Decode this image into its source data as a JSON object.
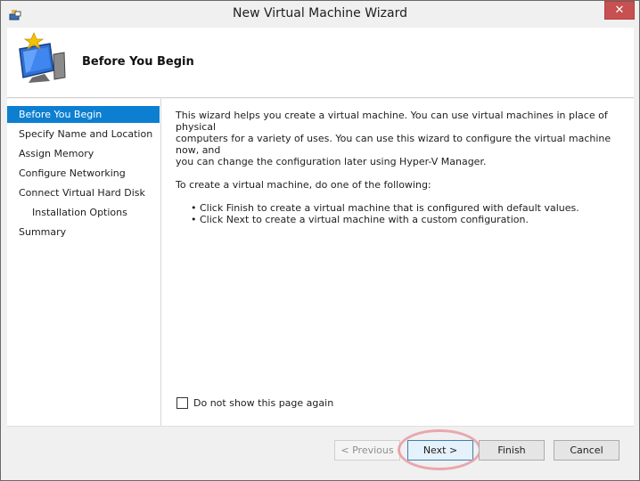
{
  "window": {
    "title": "New Virtual Machine Wizard",
    "close_glyph": "✕"
  },
  "header": {
    "title": "Before You Begin",
    "icon": "virtual-machine-star-icon"
  },
  "nav": {
    "items": [
      {
        "label": "Before You Begin",
        "active": true,
        "sub": false
      },
      {
        "label": "Specify Name and Location",
        "active": false,
        "sub": false
      },
      {
        "label": "Assign Memory",
        "active": false,
        "sub": false
      },
      {
        "label": "Configure Networking",
        "active": false,
        "sub": false
      },
      {
        "label": "Connect Virtual Hard Disk",
        "active": false,
        "sub": false
      },
      {
        "label": "Installation Options",
        "active": false,
        "sub": true
      },
      {
        "label": "Summary",
        "active": false,
        "sub": false
      }
    ]
  },
  "content": {
    "intro_line1": "This wizard helps you create a virtual machine. You can use virtual machines in place of physical",
    "intro_line2": "computers for a variety of uses. You can use this wizard to configure the virtual machine now, and",
    "intro_line3": "you can change the configuration later using Hyper-V Manager.",
    "instruction": "To create a virtual machine, do one of the following:",
    "bullet1": "• Click Finish to create a virtual machine that is configured with default values.",
    "bullet2": "• Click Next to create a virtual machine with a custom configuration."
  },
  "checkbox": {
    "label": "Do not show this page again",
    "checked": false
  },
  "buttons": {
    "previous": "< Previous",
    "next": "Next >",
    "finish": "Finish",
    "cancel": "Cancel"
  },
  "colors": {
    "accent": "#0d7fd1",
    "close": "#c75050",
    "highlight": "#e89aa2"
  }
}
